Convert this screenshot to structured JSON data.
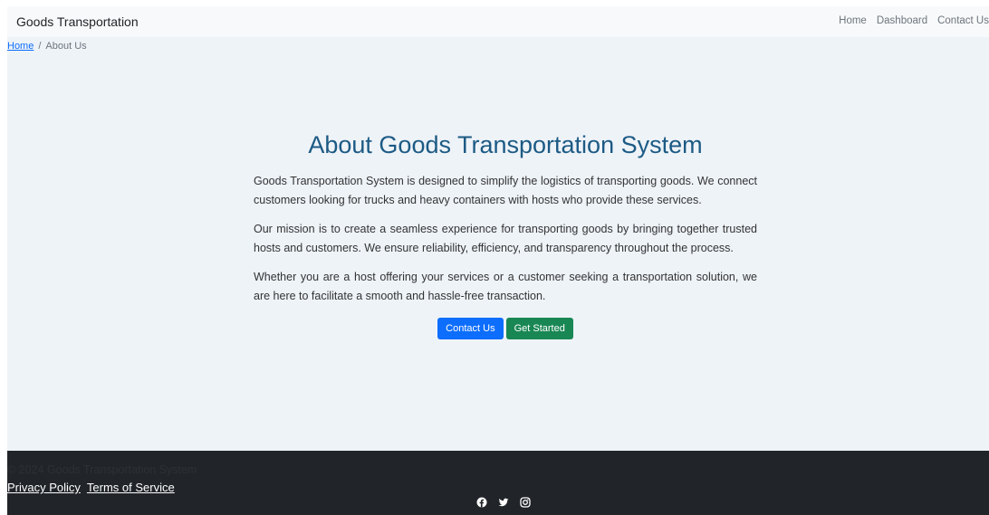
{
  "navbar": {
    "brand": "Goods Transportation",
    "links": [
      "Home",
      "Dashboard",
      "Contact Us"
    ]
  },
  "breadcrumb": {
    "home": "Home",
    "separator": "/",
    "current": "About Us"
  },
  "main": {
    "title": "About Goods Transportation System",
    "paragraphs": [
      "Goods Transportation System is designed to simplify the logistics of transporting goods. We connect customers looking for trucks and heavy containers with hosts who provide these services.",
      "Our mission is to create a seamless experience for transporting goods by bringing together trusted hosts and customers. We ensure reliability, efficiency, and transparency throughout the process.",
      "Whether you are a host offering your services or a customer seeking a transportation solution, we are here to facilitate a smooth and hassle-free transaction."
    ],
    "contact_button": "Contact Us",
    "start_button": "Get Started"
  },
  "footer": {
    "copyright": "© 2024 Goods Transportation System",
    "links": [
      "Privacy Policy",
      "Terms of Service"
    ],
    "social_icons": [
      "facebook-icon",
      "twitter-icon",
      "instagram-icon"
    ]
  },
  "colors": {
    "primary": "#0d6efd",
    "success": "#198754",
    "title": "#1c5a84",
    "footer_bg": "#212529",
    "main_bg": "#eef3f8"
  }
}
